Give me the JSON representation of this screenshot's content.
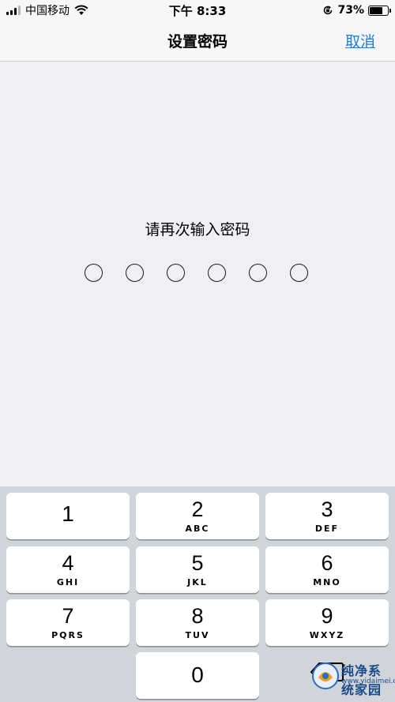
{
  "status_bar": {
    "carrier": "中国移动",
    "time": "下午 8:33",
    "battery": "73%",
    "battery_level": 0.73,
    "signal_bars_on": 3,
    "signal_bars_total": 4,
    "icons": [
      "signal-icon",
      "wifi-icon",
      "orientation-lock-icon",
      "battery-icon"
    ]
  },
  "nav": {
    "title": "设置密码",
    "cancel": "取消",
    "accent_color": "#1a7fe0"
  },
  "passcode": {
    "prompt": "请再次输入密码",
    "length": 6,
    "filled": 0
  },
  "keypad": {
    "keys": [
      {
        "digit": "1",
        "letters": ""
      },
      {
        "digit": "2",
        "letters": "ABC"
      },
      {
        "digit": "3",
        "letters": "DEF"
      },
      {
        "digit": "4",
        "letters": "GHI"
      },
      {
        "digit": "5",
        "letters": "JKL"
      },
      {
        "digit": "6",
        "letters": "MNO"
      },
      {
        "digit": "7",
        "letters": "PQRS"
      },
      {
        "digit": "8",
        "letters": "TUV"
      },
      {
        "digit": "9",
        "letters": "WXYZ"
      },
      {
        "digit": "0",
        "letters": ""
      }
    ],
    "delete_icon": "delete-backspace-icon"
  },
  "watermark": {
    "text": "纯净系统家园",
    "url": "www.yidaimei.com"
  }
}
